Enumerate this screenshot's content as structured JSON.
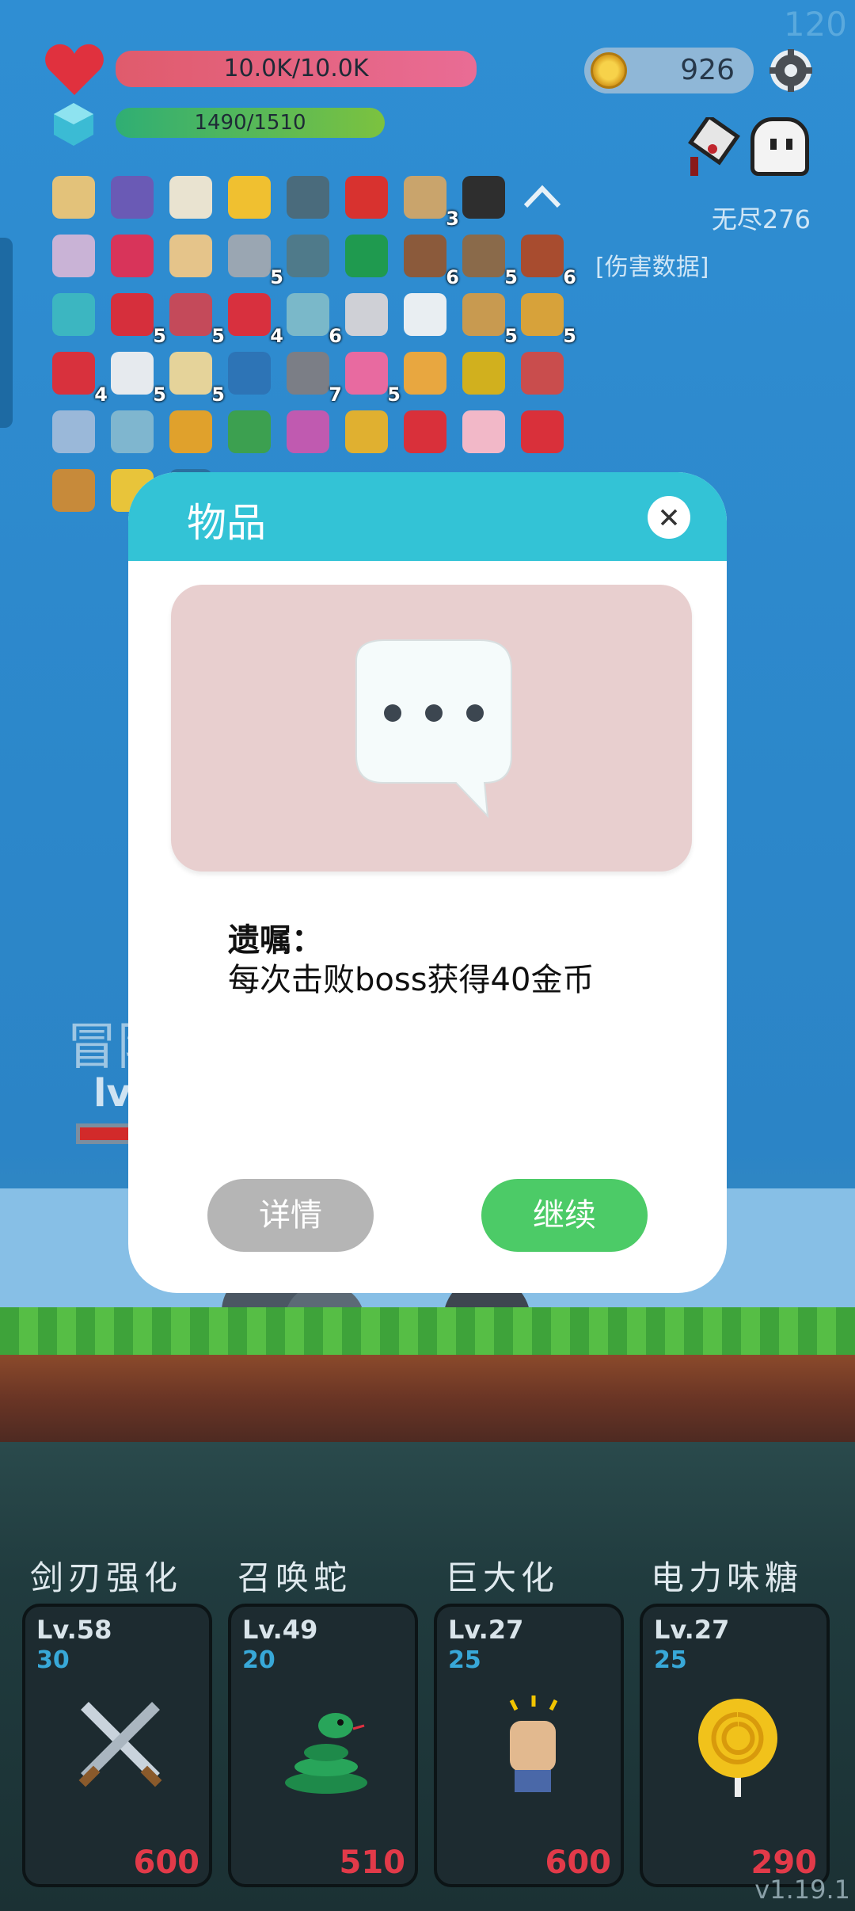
{
  "hud": {
    "fps": "120",
    "hp_text": "10.0K/10.0K",
    "mp_text": "1490/1510",
    "gold": "926",
    "mode": "无尽276",
    "damage_data": "[伤害数据]"
  },
  "inventory": [
    {
      "icon": "teacup-icon",
      "count": ""
    },
    {
      "icon": "wizard-hat-icon",
      "count": ""
    },
    {
      "icon": "molecule-icon",
      "count": ""
    },
    {
      "icon": "sun-orb-icon",
      "count": ""
    },
    {
      "icon": "mortar-icon",
      "count": ""
    },
    {
      "icon": "map-pin-icon",
      "count": ""
    },
    {
      "icon": "scroll-icon",
      "count": "3"
    },
    {
      "icon": "bat-icon",
      "count": ""
    },
    {
      "icon": "collapse-arrow-icon",
      "count": ""
    },
    {
      "icon": "unicorn-icon",
      "count": ""
    },
    {
      "icon": "ruby-icon",
      "count": ""
    },
    {
      "icon": "parchment-icon",
      "count": ""
    },
    {
      "icon": "sword-icon",
      "count": "5"
    },
    {
      "icon": "dots-grid-icon",
      "count": ""
    },
    {
      "icon": "snake-icon",
      "count": ""
    },
    {
      "icon": "coconut-icon",
      "count": "6"
    },
    {
      "icon": "shield-icon",
      "count": "5"
    },
    {
      "icon": "pirate-ship-icon",
      "count": "6"
    },
    {
      "icon": "spiral-icon",
      "count": ""
    },
    {
      "icon": "sock-icon",
      "count": "5"
    },
    {
      "icon": "armor-icon",
      "count": "5"
    },
    {
      "icon": "strawberry-icon",
      "count": "4"
    },
    {
      "icon": "ring-icon",
      "count": "6"
    },
    {
      "icon": "playing-card-icon",
      "count": ""
    },
    {
      "icon": "speech-bubble-icon",
      "count": ""
    },
    {
      "icon": "meteor-icon",
      "count": "5"
    },
    {
      "icon": "book-icon",
      "count": "5"
    },
    {
      "icon": "bookmark-icon",
      "count": "4"
    },
    {
      "icon": "envelope-icon",
      "count": "5"
    },
    {
      "icon": "treasure-map-icon",
      "count": "5"
    },
    {
      "icon": "id-card-icon",
      "count": ""
    },
    {
      "icon": "spiked-ball-icon",
      "count": "7"
    },
    {
      "icon": "potion-bottle-icon",
      "count": "5"
    },
    {
      "icon": "menu-card-icon",
      "count": ""
    },
    {
      "icon": "golden-egg-icon",
      "count": ""
    },
    {
      "icon": "meat-icon",
      "count": ""
    },
    {
      "icon": "shirt-icon",
      "count": ""
    },
    {
      "icon": "globe-icon",
      "count": ""
    },
    {
      "icon": "beer-icon",
      "count": ""
    },
    {
      "icon": "photo-icon",
      "count": ""
    },
    {
      "icon": "flower-icon",
      "count": ""
    },
    {
      "icon": "pineapple-icon",
      "count": ""
    },
    {
      "icon": "apple-icon",
      "count": ""
    },
    {
      "icon": "ice-cream-icon",
      "count": ""
    },
    {
      "icon": "heart-fruit-icon",
      "count": ""
    },
    {
      "icon": "tools-icon",
      "count": ""
    },
    {
      "icon": "crown-icon",
      "count": ""
    },
    {
      "icon": "lightbulb-frame-icon",
      "count": ""
    }
  ],
  "hero": {
    "name": "冒险",
    "level": "lv"
  },
  "skills": [
    {
      "title": "剑刃强化",
      "level": "Lv.58",
      "cost": "30",
      "price": "600",
      "icon": "crossed-swords-icon"
    },
    {
      "title": "召唤蛇",
      "level": "Lv.49",
      "cost": "20",
      "price": "510",
      "icon": "snake-icon"
    },
    {
      "title": "巨大化",
      "level": "Lv.27",
      "cost": "25",
      "price": "600",
      "icon": "fist-icon"
    },
    {
      "title": "电力味糖",
      "level": "Lv.27",
      "cost": "25",
      "price": "290",
      "icon": "lollipop-icon"
    }
  ],
  "version": "v1.19.1",
  "modal": {
    "title": "物品",
    "item_name": "遗嘱：",
    "item_desc": "每次击败boss获得40金币",
    "detail_label": "详情",
    "continue_label": "继续"
  },
  "colors": {
    "sky": "#2e86c8",
    "modal_header": "#33c3d6",
    "continue_button": "#4ccb67",
    "detail_button": "#b5b5b5",
    "price": "#e23a49"
  }
}
